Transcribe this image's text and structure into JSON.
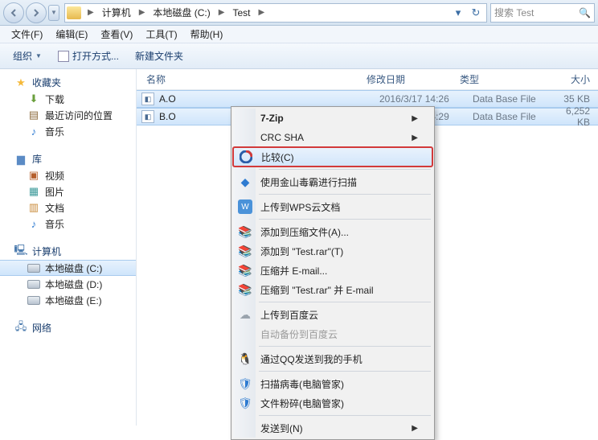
{
  "breadcrumbs": [
    "计算机",
    "本地磁盘 (C:)",
    "Test"
  ],
  "search_placeholder": "搜索 Test",
  "menubar": {
    "file": "文件(F)",
    "edit": "编辑(E)",
    "view": "查看(V)",
    "tools": "工具(T)",
    "help": "帮助(H)"
  },
  "toolbar": {
    "organize": "组织",
    "open_mode": "打开方式...",
    "new_folder": "新建文件夹"
  },
  "sidebar": {
    "favorites": {
      "label": "收藏夹",
      "items": [
        {
          "label": "下载",
          "icon": "download-icon",
          "color": "#6a9f3c"
        },
        {
          "label": "最近访问的位置",
          "icon": "recent-icon",
          "color": "#8c6b3e"
        },
        {
          "label": "音乐",
          "icon": "music-icon",
          "color": "#2e7bd1"
        }
      ]
    },
    "libraries": {
      "label": "库",
      "items": [
        {
          "label": "视频",
          "icon": "video-icon",
          "color": "#b55f2c"
        },
        {
          "label": "图片",
          "icon": "pictures-icon",
          "color": "#3c9a9a"
        },
        {
          "label": "文档",
          "icon": "documents-icon",
          "color": "#c98b3a"
        },
        {
          "label": "音乐",
          "icon": "music-icon",
          "color": "#2e7bd1"
        }
      ]
    },
    "computer": {
      "label": "计算机",
      "items": [
        {
          "label": "本地磁盘 (C:)",
          "icon": "drive-icon",
          "selected": true
        },
        {
          "label": "本地磁盘 (D:)",
          "icon": "drive-icon"
        },
        {
          "label": "本地磁盘 (E:)",
          "icon": "drive-icon"
        }
      ]
    },
    "network": {
      "label": "网络"
    }
  },
  "columns": {
    "name": "名称",
    "date": "修改日期",
    "type": "类型",
    "size": "大小"
  },
  "files": [
    {
      "name": "A.O",
      "date": "2016/3/17 14:26",
      "type": "Data Base File",
      "size": "35 KB",
      "selected": true
    },
    {
      "name": "B.O",
      "date": "2016/3/17 14:29",
      "type": "Data Base File",
      "size": "6,252 KB",
      "selected": true
    }
  ],
  "context_menu": {
    "seven_zip": "7-Zip",
    "crc_sha": "CRC SHA",
    "compare": "比较(C)",
    "scan_jinshan": "使用金山毒霸进行扫描",
    "wps_cloud": "上传到WPS云文档",
    "add_archive": "添加到压缩文件(A)...",
    "add_testrar": "添加到 \"Test.rar\"(T)",
    "compress_email": "压缩并 E-mail...",
    "compress_testrar_email": "压缩到 \"Test.rar\" 并 E-mail",
    "upload_baidu": "上传到百度云",
    "auto_backup_baidu": "自动备份到百度云",
    "send_qq": "通过QQ发送到我的手机",
    "scan_guanjia": "扫描病毒(电脑管家)",
    "shred_guanjia": "文件粉碎(电脑管家)",
    "send_to": "发送到(N)"
  }
}
